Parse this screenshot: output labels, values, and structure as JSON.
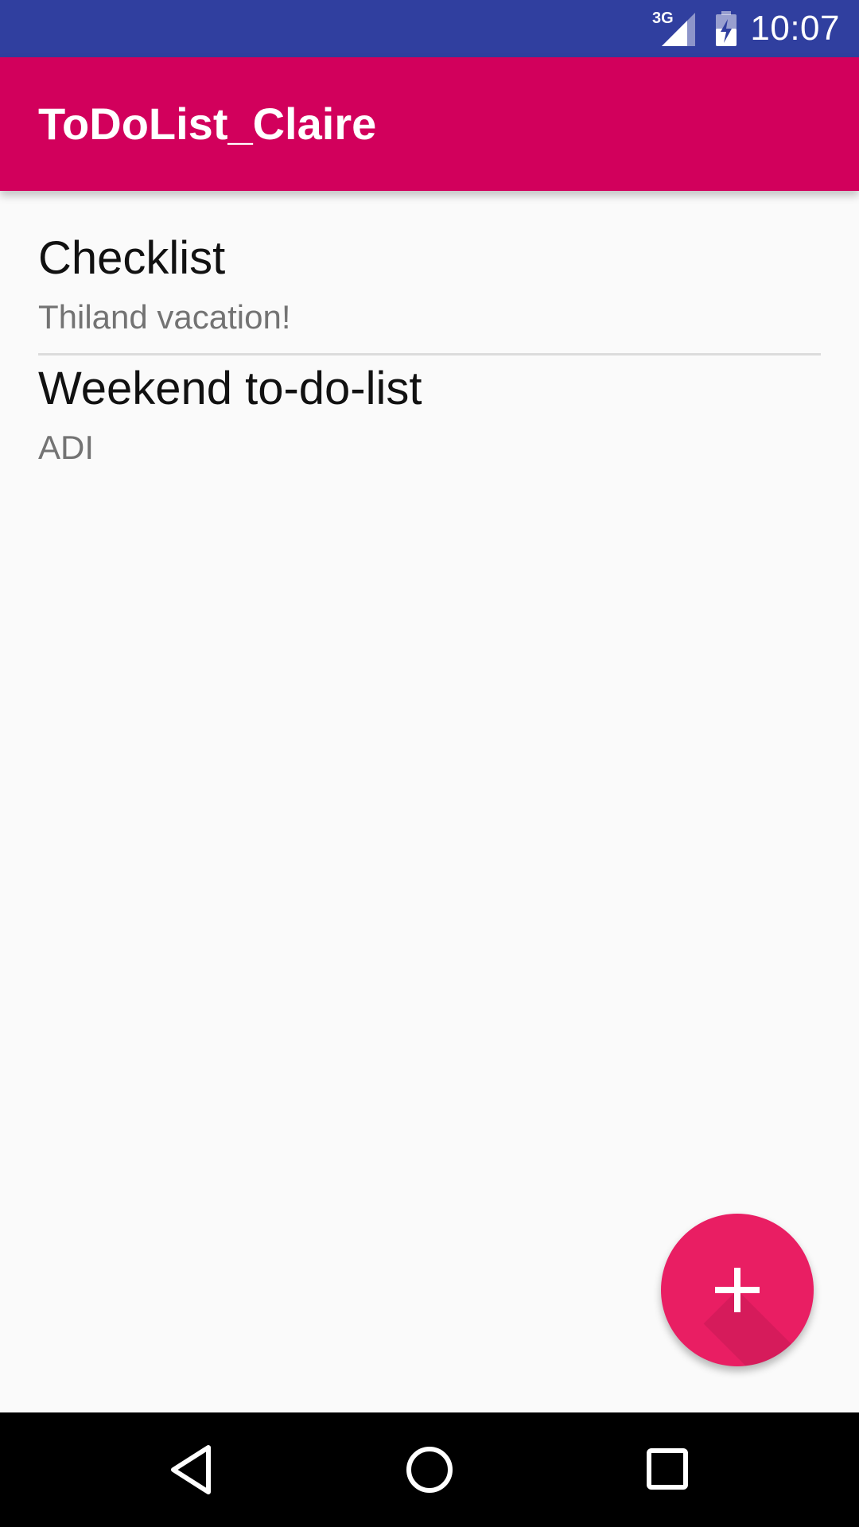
{
  "status_bar": {
    "network_label": "3G",
    "clock": "10:07",
    "icons": [
      "signal-icon",
      "battery-charging-icon"
    ]
  },
  "app_bar": {
    "title": "ToDoList_Claire",
    "color": "#d2005c"
  },
  "lists": [
    {
      "title": "Checklist",
      "subtitle": "Thiland vacation!"
    },
    {
      "title": "Weekend to-do-list",
      "subtitle": "ADI"
    }
  ],
  "fab": {
    "icon": "plus-icon",
    "color": "#e91e63"
  },
  "nav_bar": {
    "icons": [
      "back-icon",
      "home-icon",
      "recents-icon"
    ]
  },
  "colors": {
    "status_bar": "#303f9f",
    "background": "#fafafa"
  }
}
